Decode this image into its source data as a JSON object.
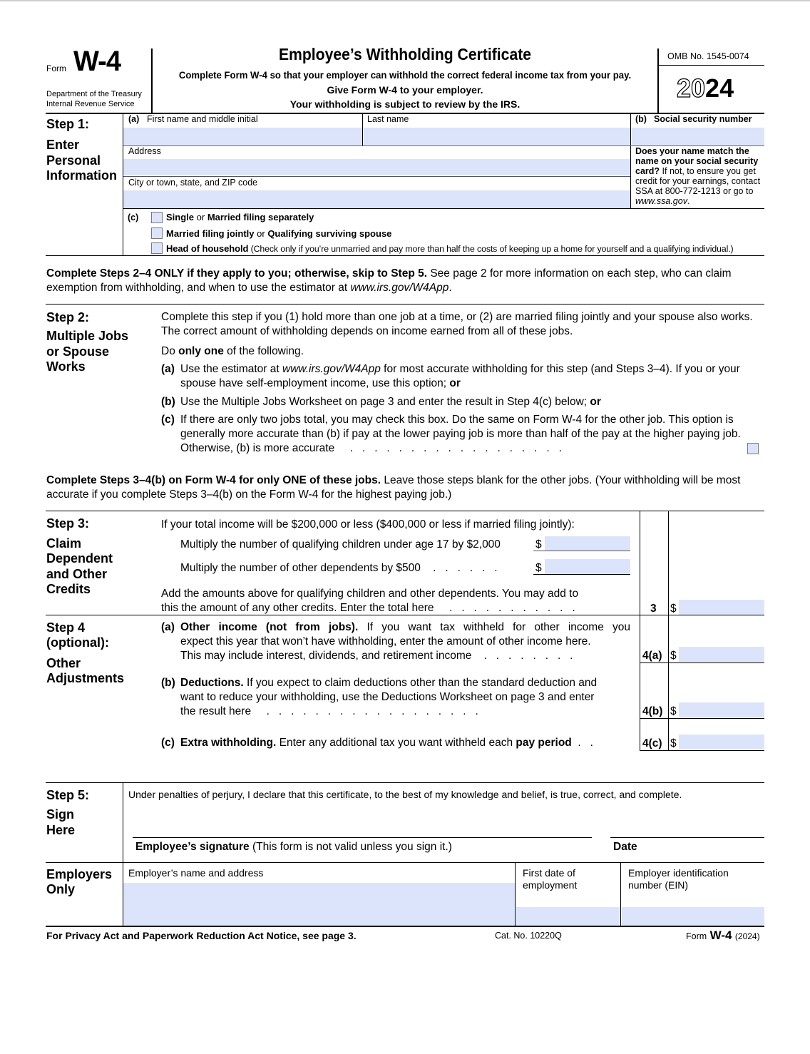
{
  "header": {
    "form_word": "Form",
    "form_name": "W-4",
    "dept_line1": "Department of the Treasury",
    "dept_line2": "Internal Revenue Service",
    "title": "Employee’s Withholding Certificate",
    "subtitle1": "Complete Form W-4 so that your employer can withhold the correct federal income tax from your pay.",
    "subtitle2": "Give Form W-4 to your employer.",
    "subtitle3": "Your withholding is subject to review by the IRS.",
    "omb": "OMB No. 1545-0074",
    "year_outline": "20",
    "year_bold": "24"
  },
  "step1": {
    "heading": "Step 1:",
    "sub1": "Enter",
    "sub2": "Personal",
    "sub3": "Information",
    "a_marker": "(a)",
    "first_name_label": "First name and middle initial",
    "first_name_value": "",
    "last_name_label": "Last name",
    "last_name_value": "",
    "b_marker": "(b)",
    "ssn_label": "Social security number",
    "ssn_value": "",
    "address_label": "Address",
    "address_value": "",
    "city_label": "City or town, state, and ZIP code",
    "city_value": "",
    "ssn_note_bold": "Does your name match the name on your social security card?",
    "ssn_note_text": " If not, to ensure you get credit for your earnings, contact SSA at 800-772-1213 or go to ",
    "ssn_note_link": "www.ssa.gov",
    "ssn_note_end": ".",
    "c_marker": "(c)",
    "filing_status": [
      {
        "bold1": "Single",
        "plain1": " or ",
        "bold2": "Married filing separately",
        "plain2": "",
        "checked": false
      },
      {
        "bold1": "Married filing jointly",
        "plain1": " or ",
        "bold2": "Qualifying surviving spouse",
        "plain2": "",
        "checked": false
      },
      {
        "bold1": "Head of household",
        "plain1": " (Check only if you’re unmarried and pay more than half the costs of keeping up a home for yourself and a qualifying individual.)",
        "bold2": "",
        "plain2": "",
        "checked": false
      }
    ]
  },
  "intro": {
    "bold": "Complete Steps 2–4 ONLY if they apply to you; otherwise, skip to Step 5.",
    "text": " See page 2 for more information on each step, who can claim exemption from withholding, and when to use the estimator at ",
    "link": "www.irs.gov/W4App",
    "end": "."
  },
  "step2": {
    "heading": "Step 2:",
    "sub1": "Multiple Jobs",
    "sub2": "or Spouse",
    "sub3": "Works",
    "para1": "Complete this step if you (1) hold more than one job at a time, or (2) are married filing jointly and your spouse also works. The correct amount of withholding depends on income earned from all of these jobs.",
    "do_pre": "Do ",
    "do_bold": "only one",
    "do_post": " of the following.",
    "a_marker": "(a)",
    "a_pre": "Use the estimator at ",
    "a_link": "www.irs.gov/W4App",
    "a_post": " for most accurate withholding for this step (and Steps 3–4). If you or your spouse have self-employment income, use this option; ",
    "a_or": "or",
    "b_marker": "(b)",
    "b_text": "Use the Multiple Jobs Worksheet on page 3 and enter the result in Step 4(c) below; ",
    "b_or": "or",
    "c_marker": "(c)",
    "c_text": "If there are only two jobs total, you may check this box. Do the same on Form W-4 for the other job. This option is generally more accurate than (b) if pay at the lower paying job is more than half of the pay at the higher paying job. Otherwise, (b) is more accurate",
    "c_checked": false
  },
  "intro2": {
    "bold": "Complete Steps 3–4(b) on Form W-4 for only ONE of these jobs.",
    "text": " Leave those steps blank for the other jobs. (Your withholding will be most accurate if you complete Steps 3–4(b) on the Form W-4 for the highest paying job.)"
  },
  "step3": {
    "heading": "Step 3:",
    "sub1": "Claim",
    "sub2": "Dependent",
    "sub3": "and Other",
    "sub4": "Credits",
    "intro": "If your total income will be $200,000 or less ($400,000 or less if married filing jointly):",
    "children_label": "Multiply the number of qualifying children under age 17 by $2,000",
    "children_value": "",
    "other_label": "Multiply the number of other dependents by $500",
    "other_value": "",
    "dollar": "$",
    "total_text1": "Add the amounts above for qualifying children and other dependents. You may add to",
    "total_text2": "this the amount of any other credits. Enter the total here",
    "line_no": "3",
    "total_value": ""
  },
  "step4": {
    "heading1": "Step 4",
    "heading2": "(optional):",
    "sub1": "Other",
    "sub2": "Adjustments",
    "a_marker": "(a)",
    "a_bold": "Other income (not from jobs).",
    "a_line1": " If you want tax withheld for other income you",
    "a_line2": "expect this year that won’t have withholding, enter the amount of other income here.",
    "a_line3": "This may include interest, dividends, and retirement income",
    "a_no": "4(a)",
    "a_value": "",
    "b_marker": "(b)",
    "b_bold": "Deductions.",
    "b_line1": " If you expect to claim deductions other than the standard deduction and",
    "b_line2": "want to reduce your withholding, use the Deductions Worksheet on page 3 and enter",
    "b_line3": "the result here",
    "b_no": "4(b)",
    "b_value": "",
    "c_marker": "(c)",
    "c_bold": "Extra withholding.",
    "c_text": " Enter any additional tax you want withheld each ",
    "c_bold2": "pay period",
    "c_no": "4(c)",
    "c_value": "",
    "dollar": "$"
  },
  "step5": {
    "heading": "Step 5:",
    "sub1": "Sign",
    "sub2": "Here",
    "perjury": "Under penalties of perjury, I declare that this certificate, to the best of my knowledge and belief, is true, correct, and complete.",
    "sig_bold": "Employee’s signature",
    "sig_text": " (This form is not valid unless you sign it.)",
    "date_label": "Date",
    "signature_value": "",
    "date_value": ""
  },
  "employers": {
    "heading1": "Employers",
    "heading2": "Only",
    "name_label": "Employer’s name and address",
    "name_value": "",
    "first_date_label1": "First date of",
    "first_date_label2": "employment",
    "first_date_value": "",
    "ein_label1": "Employer identification",
    "ein_label2": "number (EIN)",
    "ein_value": ""
  },
  "footer": {
    "privacy": "For Privacy Act and Paperwork Reduction Act Notice, see page 3.",
    "cat": "Cat. No. 10220Q",
    "form_word": "Form",
    "form_name": "W-4",
    "year": "(2024)"
  },
  "colors": {
    "field_fill": "#dce4fb",
    "ink": "#000000"
  }
}
